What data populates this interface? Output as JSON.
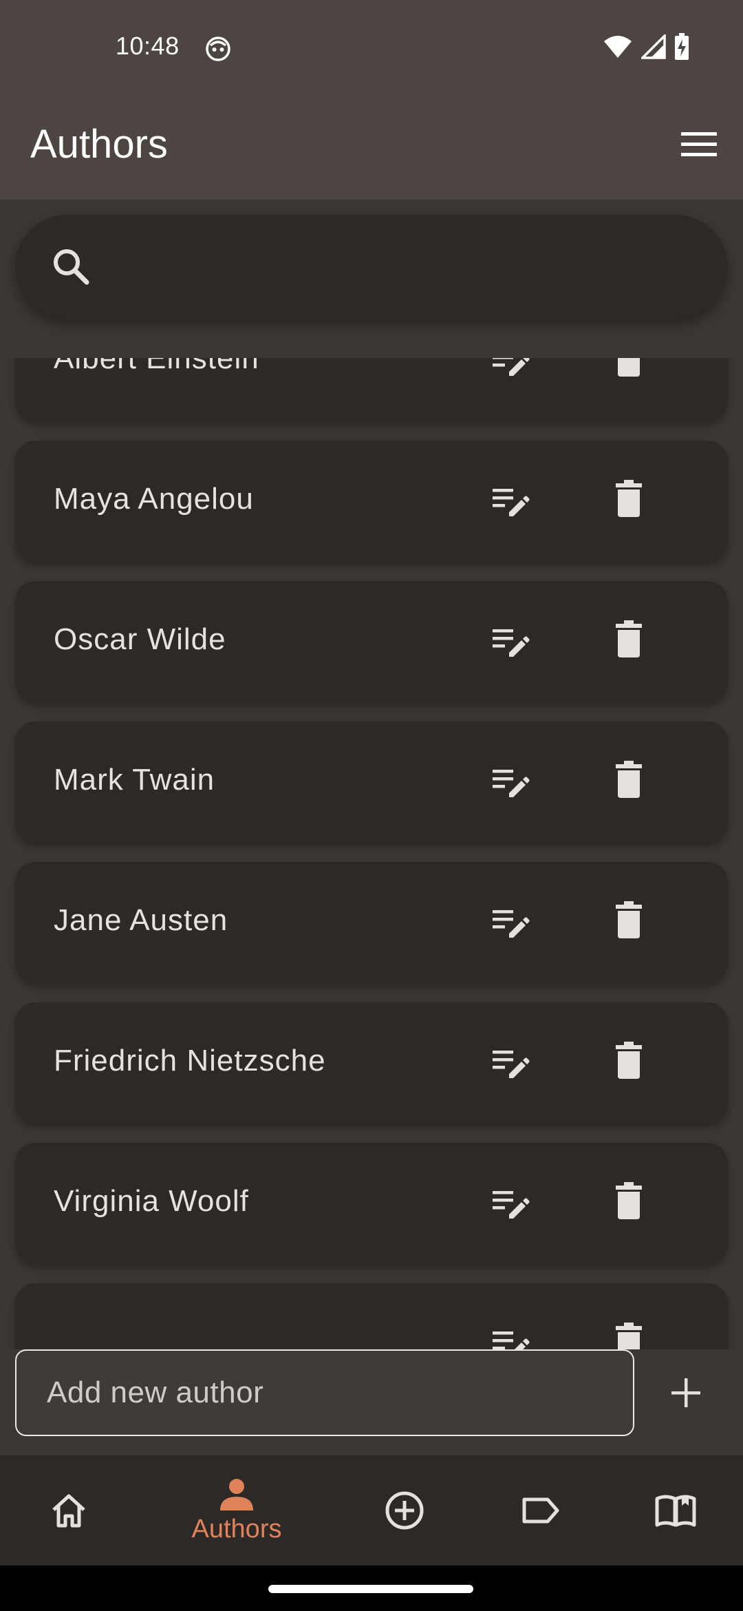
{
  "status_bar": {
    "time": "10:48"
  },
  "app_bar": {
    "title": "Authors"
  },
  "search": {
    "placeholder": "",
    "value": ""
  },
  "authors": [
    {
      "name": "Albert Einstein"
    },
    {
      "name": "Maya Angelou"
    },
    {
      "name": "Oscar Wilde"
    },
    {
      "name": "Mark Twain"
    },
    {
      "name": "Jane Austen"
    },
    {
      "name": "Friedrich Nietzsche"
    },
    {
      "name": "Virginia Woolf"
    },
    {
      "name": ""
    }
  ],
  "add_author": {
    "placeholder": "Add new author",
    "value": ""
  },
  "bottom_nav": {
    "items": [
      {
        "icon": "home-icon",
        "label": "",
        "selected": false
      },
      {
        "icon": "person-icon",
        "label": "Authors",
        "selected": true
      },
      {
        "icon": "add-circle-icon",
        "label": "",
        "selected": false
      },
      {
        "icon": "label-icon",
        "label": "",
        "selected": false
      },
      {
        "icon": "book-icon",
        "label": "",
        "selected": false
      }
    ]
  },
  "colors": {
    "app_bar": "#4d4542",
    "background": "#3b3735",
    "card": "#2d2927",
    "accent": "#e0825a",
    "text": "#e4e0dd"
  }
}
